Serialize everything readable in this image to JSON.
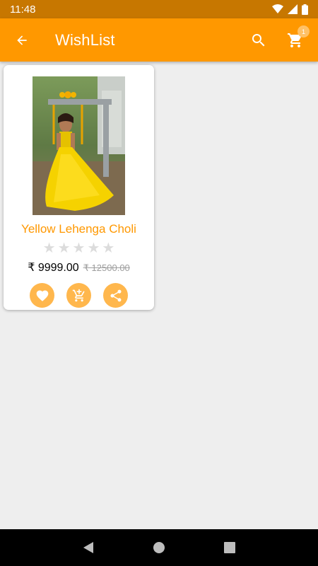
{
  "status_bar": {
    "time": "11:48"
  },
  "app_bar": {
    "title": "WishList",
    "cart_count": "1"
  },
  "product": {
    "name": "Yellow Lehenga Choli",
    "rating": 0,
    "rating_max": 5,
    "price": "₹ 9999.00",
    "original_price": "₹ 12500.00"
  },
  "colors": {
    "primary": "#ff9800",
    "status_bar": "#c77700",
    "accent_button": "#ffb74d"
  },
  "icons": [
    "arrow-back-icon",
    "search-icon",
    "cart-icon",
    "heart-icon",
    "add-cart-icon",
    "share-icon"
  ]
}
